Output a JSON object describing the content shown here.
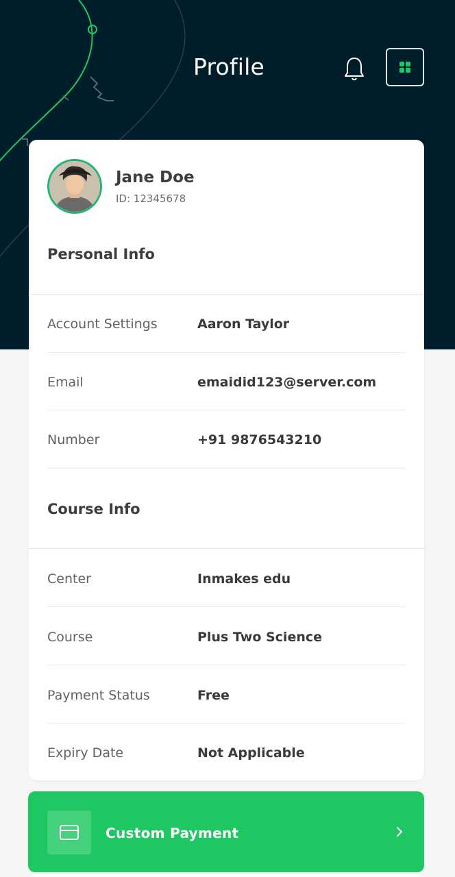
{
  "header": {
    "title": "Profile",
    "bell_icon": "bell-icon",
    "menu_icon": "grid-menu-icon",
    "background_color": "#001d2a",
    "accent_color": "#1ec765"
  },
  "profile": {
    "name": "Jane Doe",
    "id_text": "ID: 12345678"
  },
  "personal_info": {
    "title": "Personal Info",
    "rows": [
      {
        "label": "Account Settings",
        "value": "Aaron Taylor"
      },
      {
        "label": "Email",
        "value": "emaidid123@server.com"
      },
      {
        "label": "Number",
        "value": "+91 9876543210"
      }
    ]
  },
  "course_info": {
    "title": "Course Info",
    "rows": [
      {
        "label": "Center",
        "value": "Inmakes edu"
      },
      {
        "label": "Course",
        "value": "Plus Two Science"
      },
      {
        "label": "Payment Status",
        "value": "Free"
      },
      {
        "label": "Expiry Date",
        "value": "Not Applicable"
      }
    ]
  },
  "payment_button": {
    "label": "Custom Payment",
    "icon": "credit-card-icon",
    "chevron_icon": "chevron-right-icon",
    "color": "#1ec761"
  }
}
